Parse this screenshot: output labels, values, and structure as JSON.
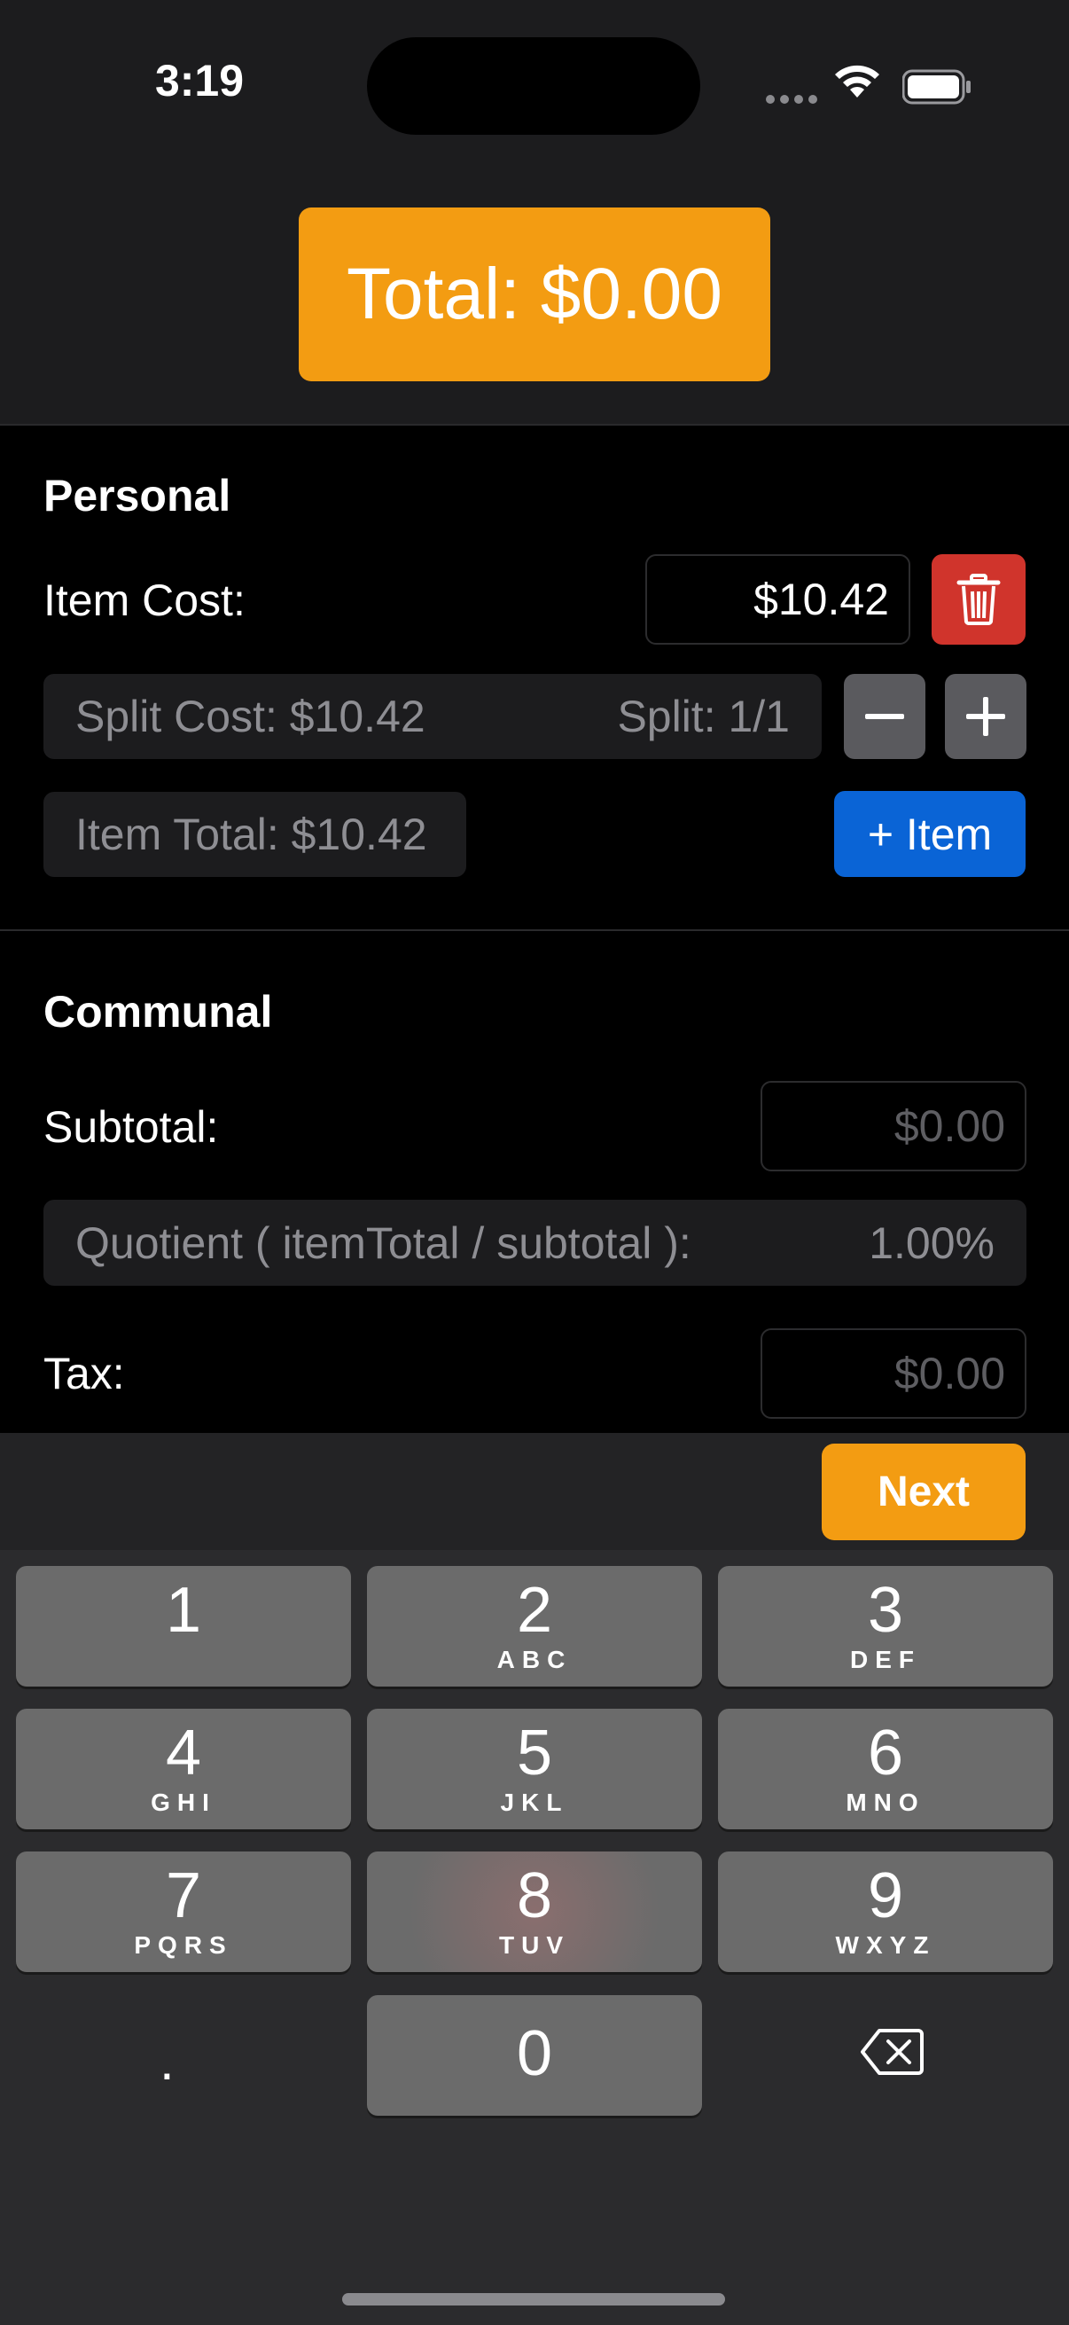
{
  "status_bar": {
    "time": "3:19"
  },
  "header": {
    "total_label": "Total: $0.00"
  },
  "personal": {
    "title": "Personal",
    "item_cost_label": "Item Cost:",
    "item_cost_value": "$10.42",
    "split_cost": "Split Cost: $10.42",
    "split": "Split: 1/1",
    "minus": "−",
    "plus": "+",
    "item_total": "Item Total: $10.42",
    "add_item": "+ Item"
  },
  "communal": {
    "title": "Communal",
    "subtotal_label": "Subtotal:",
    "subtotal_placeholder": "$0.00",
    "quotient_label": "Quotient ( itemTotal / subtotal ):",
    "quotient_value": "1.00%",
    "tax_label": "Tax:",
    "tax_placeholder": "$0.00"
  },
  "keyboard": {
    "next_label": "Next",
    "keys": [
      {
        "digit": "1",
        "letters": ""
      },
      {
        "digit": "2",
        "letters": "ABC"
      },
      {
        "digit": "3",
        "letters": "DEF"
      },
      {
        "digit": "4",
        "letters": "GHI"
      },
      {
        "digit": "5",
        "letters": "JKL"
      },
      {
        "digit": "6",
        "letters": "MNO"
      },
      {
        "digit": "7",
        "letters": "PQRS"
      },
      {
        "digit": "8",
        "letters": "TUV"
      },
      {
        "digit": "9",
        "letters": "WXYZ"
      }
    ],
    "dot": ".",
    "zero": "0"
  },
  "colors": {
    "accent_orange": "#f39c12",
    "delete_red": "#d0342c",
    "add_blue": "#0a64d6"
  }
}
